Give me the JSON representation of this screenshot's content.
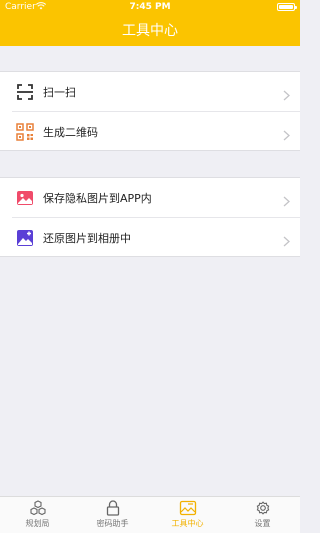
{
  "status_bar": {
    "carrier": "Carrier",
    "time": "7:45 PM"
  },
  "header": {
    "title": "工具中心"
  },
  "groups": [
    {
      "items": [
        {
          "label": "扫一扫",
          "icon": "scan-icon"
        },
        {
          "label": "生成二维码",
          "icon": "qr-code-icon"
        }
      ]
    },
    {
      "items": [
        {
          "label": "保存隐私图片到APP内",
          "icon": "save-image-icon"
        },
        {
          "label": "还原图片到相册中",
          "icon": "restore-image-icon"
        }
      ]
    }
  ],
  "tabbar": {
    "tabs": [
      {
        "label": "规划局",
        "icon": "cubes-icon",
        "active": false
      },
      {
        "label": "密码助手",
        "icon": "lock-icon",
        "active": false
      },
      {
        "label": "工具中心",
        "icon": "toolbox-icon",
        "active": true
      },
      {
        "label": "设置",
        "icon": "gear-icon",
        "active": false
      }
    ]
  },
  "colors": {
    "accent": "#fbc400",
    "active_tab": "#f2b100",
    "background": "#efeff4"
  }
}
